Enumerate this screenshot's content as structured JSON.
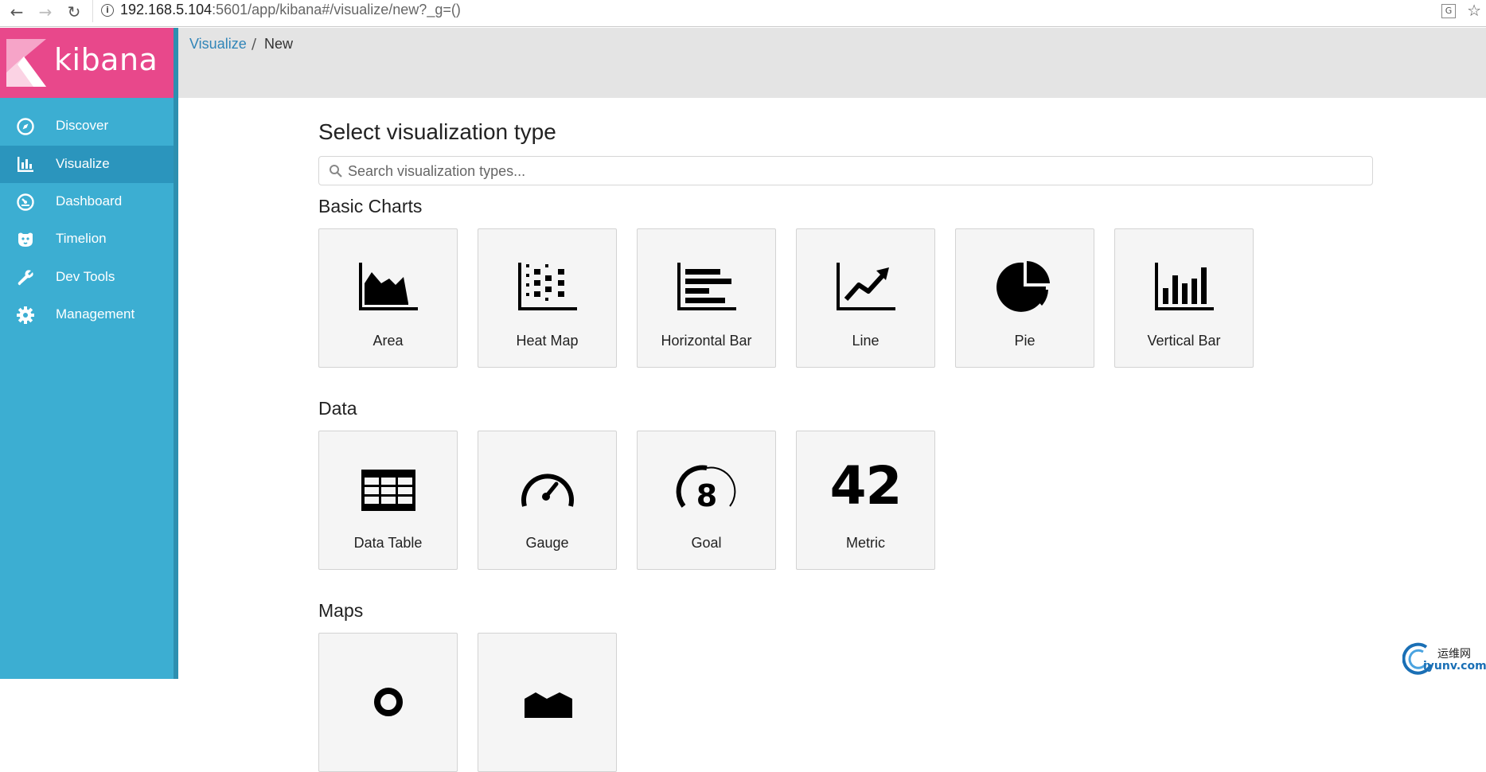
{
  "browser": {
    "url_host": "192.168.5.104",
    "url_rest": ":5601/app/kibana#/visualize/new?_g=()"
  },
  "app": {
    "logo_text": "kibana"
  },
  "sidebar": {
    "items": [
      {
        "label": "Discover",
        "icon": "compass-icon"
      },
      {
        "label": "Visualize",
        "icon": "bar-chart-icon",
        "active": true
      },
      {
        "label": "Dashboard",
        "icon": "dashboard-icon"
      },
      {
        "label": "Timelion",
        "icon": "timelion-icon"
      },
      {
        "label": "Dev Tools",
        "icon": "wrench-icon"
      },
      {
        "label": "Management",
        "icon": "gear-icon"
      }
    ]
  },
  "breadcrumb": {
    "parent": "Visualize",
    "separator": "/",
    "current": "New"
  },
  "main": {
    "title": "Select visualization type",
    "search_placeholder": "Search visualization types...",
    "sections": [
      {
        "title": "Basic Charts",
        "cards": [
          "Area",
          "Heat Map",
          "Horizontal Bar",
          "Line",
          "Pie",
          "Vertical Bar"
        ]
      },
      {
        "title": "Data",
        "cards": [
          "Data Table",
          "Gauge",
          "Goal",
          "Metric"
        ]
      },
      {
        "title": "Maps",
        "cards": [
          "",
          ""
        ]
      }
    ],
    "metric_value": "42",
    "goal_value": "8"
  },
  "watermark": {
    "line1": "运维网",
    "line2": "iyunv.com"
  }
}
